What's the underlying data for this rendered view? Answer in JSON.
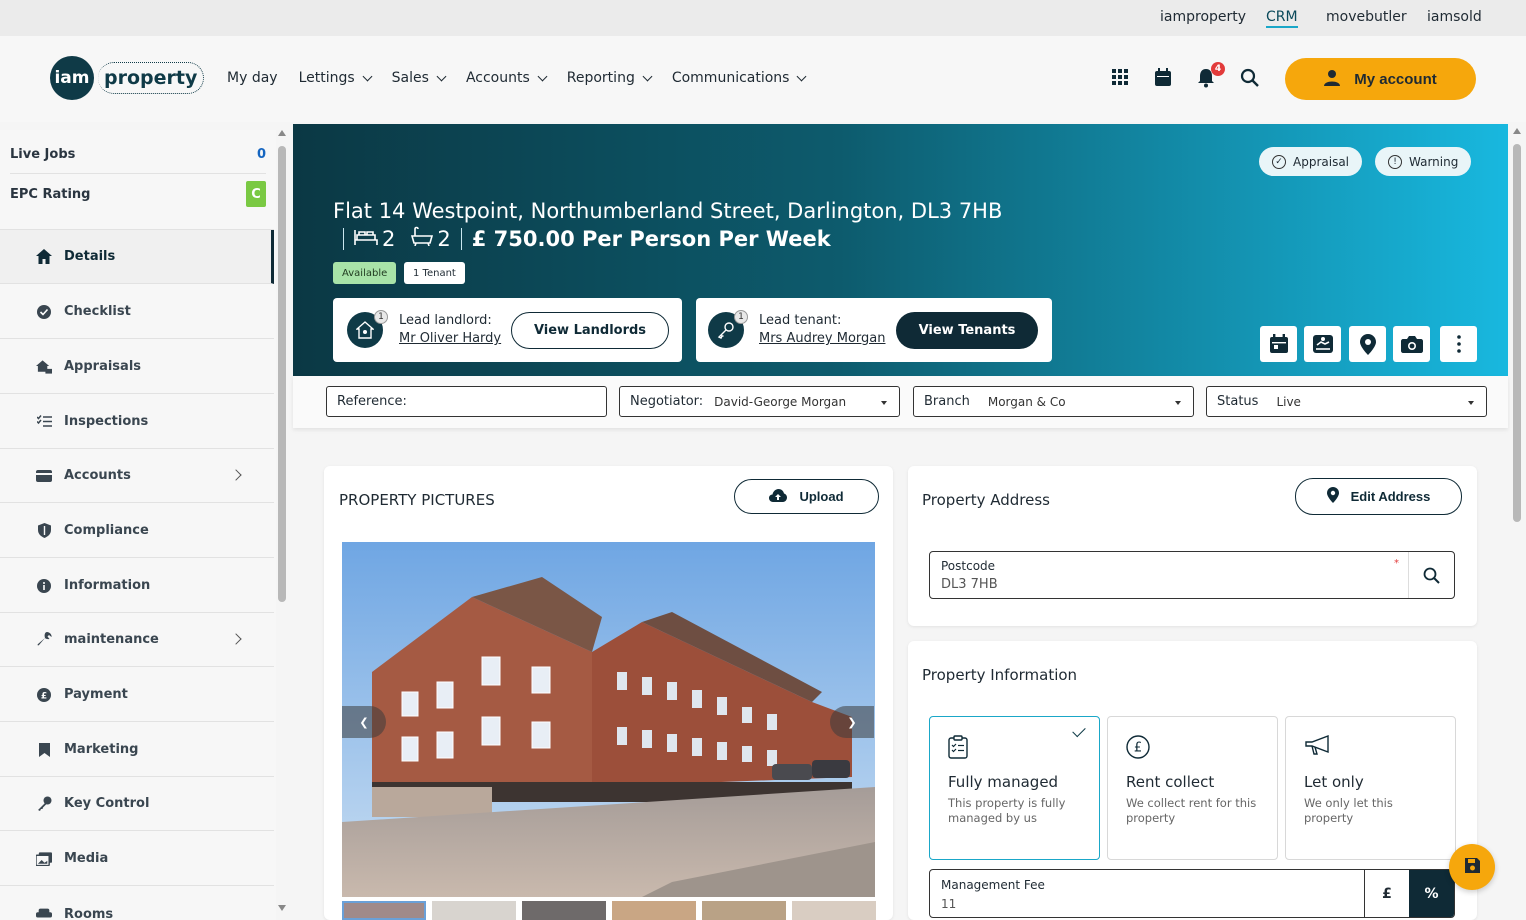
{
  "top_links": [
    "iamproperty",
    "CRM",
    "movebutler",
    "iamsold"
  ],
  "top_links_active": "CRM",
  "logo": {
    "mark": "iam",
    "word": "property"
  },
  "nav": [
    {
      "label": "My day",
      "dropdown": false
    },
    {
      "label": "Lettings",
      "dropdown": true
    },
    {
      "label": "Sales",
      "dropdown": true
    },
    {
      "label": "Accounts",
      "dropdown": true
    },
    {
      "label": "Reporting",
      "dropdown": true
    },
    {
      "label": "Communications",
      "dropdown": true
    }
  ],
  "header_icons": [
    "apps-grid-icon",
    "calendar-icon",
    "bell-icon",
    "search-icon"
  ],
  "notifications_count": "4",
  "my_account_label": "My account",
  "sidebar": {
    "live_jobs_label": "Live Jobs",
    "live_jobs_value": "0",
    "epc_label": "EPC Rating",
    "epc_value": "C",
    "items": [
      {
        "label": "Details",
        "icon": "home-icon",
        "active": true,
        "expand": false
      },
      {
        "label": "Checklist",
        "icon": "check-circle-icon",
        "active": false,
        "expand": false
      },
      {
        "label": "Appraisals",
        "icon": "house-hand-icon",
        "active": false,
        "expand": false
      },
      {
        "label": "Inspections",
        "icon": "list-check-icon",
        "active": false,
        "expand": false
      },
      {
        "label": "Accounts",
        "icon": "wallet-icon",
        "active": false,
        "expand": true
      },
      {
        "label": "Compliance",
        "icon": "shield-icon",
        "active": false,
        "expand": false
      },
      {
        "label": "Information",
        "icon": "info-icon",
        "active": false,
        "expand": false
      },
      {
        "label": "maintenance",
        "icon": "wrench-icon",
        "active": false,
        "expand": true
      },
      {
        "label": "Payment",
        "icon": "pound-icon",
        "active": false,
        "expand": false
      },
      {
        "label": "Marketing",
        "icon": "bookmark-icon",
        "active": false,
        "expand": false
      },
      {
        "label": "Key Control",
        "icon": "key-icon",
        "active": false,
        "expand": false
      },
      {
        "label": "Media",
        "icon": "images-icon",
        "active": false,
        "expand": false
      },
      {
        "label": "Rooms",
        "icon": "sofa-icon",
        "active": false,
        "expand": false
      }
    ]
  },
  "hero": {
    "address": "Flat 14 Westpoint, Northumberland Street, Darlington, DL3 7HB",
    "bedrooms": "2",
    "bathrooms": "2",
    "price": "£ 750.00 Per Person Per Week",
    "status_pill": "Available",
    "tenant_pill": "1 Tenant",
    "tags": [
      "Appraisal",
      "Warning"
    ],
    "landlord": {
      "label": "Lead landlord:",
      "name": "Mr Oliver Hardy",
      "count": "1",
      "button": "View Landlords"
    },
    "tenant": {
      "label": "Lead tenant:",
      "name": "Mrs Audrey Morgan",
      "count": "1",
      "button": "View Tenants"
    },
    "action_icons": [
      "calendar-icon",
      "handshake-icon",
      "map-pin-icon",
      "camera-icon",
      "more-vertical-icon"
    ]
  },
  "filters": {
    "reference": {
      "label": "Reference:",
      "value": ""
    },
    "negotiator": {
      "label": "Negotiator:",
      "value": "David-George Morgan"
    },
    "branch": {
      "label": "Branch",
      "value": "Morgan & Co"
    },
    "status": {
      "label": "Status",
      "value": "Live"
    }
  },
  "pictures": {
    "title": "PROPERTY PICTURES",
    "upload_label": "Upload",
    "thumb_count": 6
  },
  "address_card": {
    "title": "Property Address",
    "edit_label": "Edit Address",
    "postcode_label": "Postcode",
    "postcode_value": "DL3 7HB",
    "required_mark": "*"
  },
  "info_card": {
    "title": "Property Information",
    "options": [
      {
        "title": "Fully managed",
        "desc": "This property is fully managed by us",
        "icon": "clipboard-list-icon",
        "selected": true
      },
      {
        "title": "Rent collect",
        "desc": "We collect rent for this property",
        "icon": "pound-circle-icon",
        "selected": false
      },
      {
        "title": "Let only",
        "desc": "We only let this property",
        "icon": "megaphone-icon",
        "selected": false
      }
    ],
    "fee_label": "Management Fee",
    "fee_value": "11",
    "fee_pound": "£",
    "fee_percent": "%"
  },
  "colors": {
    "accent_orange": "#f6a70c",
    "dark_teal": "#0f3a47",
    "cyan": "#18b8df",
    "available_green": "#a8e3a8",
    "epc_green": "#7ac943"
  }
}
